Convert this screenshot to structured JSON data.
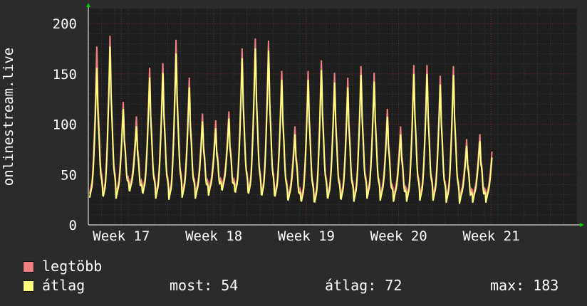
{
  "chart_data": {
    "type": "line",
    "ylabel": "onlinestream.live",
    "ylim": [
      0,
      215
    ],
    "yticks": [
      0,
      50,
      100,
      150,
      200
    ],
    "xticks": [
      "Week 17",
      "Week 18",
      "Week 19",
      "Week 20",
      "Week 21"
    ],
    "xlim_days": [
      0,
      37
    ],
    "grid": true,
    "colors": {
      "background": "#2b2b2b",
      "canvas": "#1e1e1e",
      "grid_minor": "#3a3a3a",
      "grid_major": "#7a2a2a",
      "axis": "#ffffff",
      "arrow": "#00cc00",
      "max_series": "#f08080",
      "avg_series": "#ffff80"
    },
    "daily_pattern_note": "",
    "days": [
      {
        "peak_max": 182,
        "peak_avg": 160,
        "min": 31
      },
      {
        "peak_max": 193,
        "peak_avg": 182,
        "min": 30
      },
      {
        "peak_max": 125,
        "peak_avg": 118,
        "min": 30
      },
      {
        "peak_max": 110,
        "peak_avg": 100,
        "min": 35
      },
      {
        "peak_max": 160,
        "peak_avg": 150,
        "min": 33
      },
      {
        "peak_max": 165,
        "peak_avg": 155,
        "min": 30
      },
      {
        "peak_max": 189,
        "peak_avg": 175,
        "min": 29
      },
      {
        "peak_max": 150,
        "peak_avg": 140,
        "min": 31
      },
      {
        "peak_max": 113,
        "peak_avg": 105,
        "min": 30
      },
      {
        "peak_max": 106,
        "peak_avg": 98,
        "min": 33
      },
      {
        "peak_max": 115,
        "peak_avg": 108,
        "min": 36
      },
      {
        "peak_max": 180,
        "peak_avg": 170,
        "min": 34
      },
      {
        "peak_max": 190,
        "peak_avg": 180,
        "min": 33
      },
      {
        "peak_max": 188,
        "peak_avg": 178,
        "min": 31
      },
      {
        "peak_max": 157,
        "peak_avg": 148,
        "min": 30
      },
      {
        "peak_max": 100,
        "peak_avg": 92,
        "min": 26
      },
      {
        "peak_max": 157,
        "peak_avg": 148,
        "min": 25
      },
      {
        "peak_max": 168,
        "peak_avg": 158,
        "min": 24
      },
      {
        "peak_max": 155,
        "peak_avg": 145,
        "min": 28
      },
      {
        "peak_max": 150,
        "peak_avg": 140,
        "min": 27
      },
      {
        "peak_max": 162,
        "peak_avg": 153,
        "min": 27
      },
      {
        "peak_max": 155,
        "peak_avg": 146,
        "min": 30
      },
      {
        "peak_max": 118,
        "peak_avg": 110,
        "min": 28
      },
      {
        "peak_max": 100,
        "peak_avg": 92,
        "min": 27
      },
      {
        "peak_max": 163,
        "peak_avg": 154,
        "min": 27
      },
      {
        "peak_max": 163,
        "peak_avg": 154,
        "min": 28
      },
      {
        "peak_max": 152,
        "peak_avg": 143,
        "min": 28
      },
      {
        "peak_max": 162,
        "peak_avg": 153,
        "min": 26
      },
      {
        "peak_max": 87,
        "peak_avg": 80,
        "min": 25
      },
      {
        "peak_max": 92,
        "peak_avg": 85,
        "min": 26
      }
    ],
    "series": [
      {
        "name": "legtöbb",
        "color": "#f08080"
      },
      {
        "name": "átlag",
        "color": "#ffff80"
      }
    ]
  },
  "legend": {
    "max_label": "legtöbb",
    "avg_label": "átlag"
  },
  "stats": {
    "current": "most: 54",
    "average": "átlag: 72",
    "maximum": "max: 183"
  }
}
